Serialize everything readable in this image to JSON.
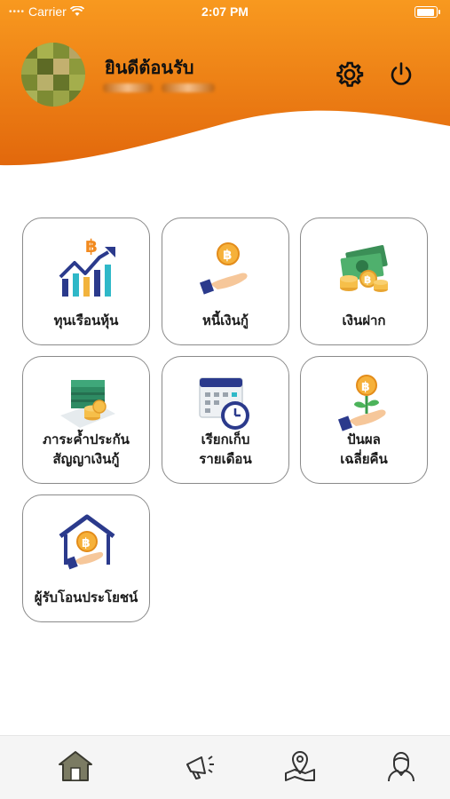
{
  "status_bar": {
    "carrier": "Carrier",
    "time": "2:07 PM"
  },
  "header": {
    "welcome": "ยินดีต้อนรับ",
    "colors": {
      "top": "#f7941d",
      "bottom": "#e0640a"
    }
  },
  "menu": {
    "items": [
      {
        "label_lines": [
          "ทุนเรือนหุ้น"
        ],
        "icon": "stock-growth-chart-icon"
      },
      {
        "label_lines": [
          "หนี้เงินกู้"
        ],
        "icon": "hand-coin-loan-icon"
      },
      {
        "label_lines": [
          "เงินฝาก"
        ],
        "icon": "money-deposit-icon"
      },
      {
        "label_lines": [
          "ภาระค้ำประกัน",
          "สัญญาเงินกู้"
        ],
        "icon": "guarantee-documents-icon"
      },
      {
        "label_lines": [
          "เรียกเก็บ",
          "รายเดือน"
        ],
        "icon": "calendar-clock-icon"
      },
      {
        "label_lines": [
          "ปันผล",
          "เฉลี่ยคืน"
        ],
        "icon": "dividend-plant-icon"
      },
      {
        "label_lines": [
          "ผู้รับโอนประโยชน์"
        ],
        "icon": "beneficiary-house-icon"
      }
    ]
  },
  "tabbar": {
    "items": [
      {
        "icon": "home-icon",
        "selected": true
      },
      {
        "icon": "megaphone-icon",
        "selected": false
      },
      {
        "icon": "map-pin-icon",
        "selected": false
      },
      {
        "icon": "user-profile-icon",
        "selected": false
      }
    ]
  }
}
